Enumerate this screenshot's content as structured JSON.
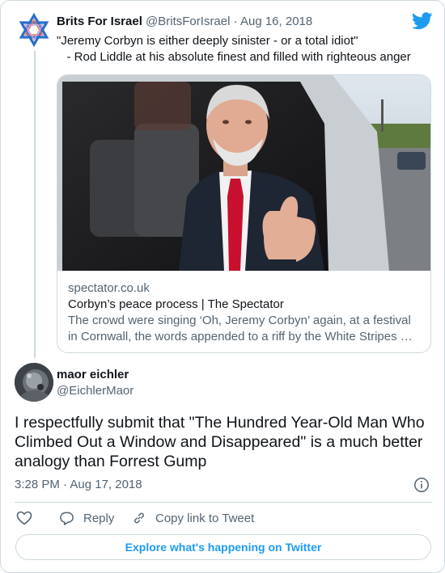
{
  "parent_tweet": {
    "author_name": "Brits For Israel",
    "author_handle": "@BritsForIsrael",
    "separator": "·",
    "date": "Aug 16, 2018",
    "text_line1": "\"Jeremy Corbyn is either deeply sinister - or a total idiot\"",
    "text_line2": "   - Rod Liddle at his absolute finest and filled with righteous anger",
    "link_card": {
      "domain": "spectator.co.uk",
      "title": "Corbyn’s peace process | The Spectator",
      "description_line1": "The crowd were singing ‘Oh, Jeremy Corbyn’ again, at a festival",
      "description_line2": "in Cornwall, the words appended to a riff by the White Stripes …"
    }
  },
  "main_tweet": {
    "author_name": "maor eichler",
    "author_handle": "@EichlerMaor",
    "text": "I respectfully submit that \"The Hundred Year-Old Man Who Climbed Out a Window and Disappeared\" is a much better analogy than Forrest Gump",
    "timestamp": "3:28 PM · Aug 17, 2018"
  },
  "actions": {
    "reply_label": "Reply",
    "copy_link_label": "Copy link to Tweet"
  },
  "explore_label": "Explore what's happening on Twitter",
  "icons": {
    "brand": "twitter-bird-icon",
    "like": "heart-icon",
    "reply": "speech-bubble-icon",
    "copy": "link-icon",
    "info": "info-icon"
  },
  "colors": {
    "brand_blue": "#1d9bf0",
    "star_blue": "#2a6fc9",
    "secondary_text": "#536471",
    "border": "#cfd9de"
  }
}
